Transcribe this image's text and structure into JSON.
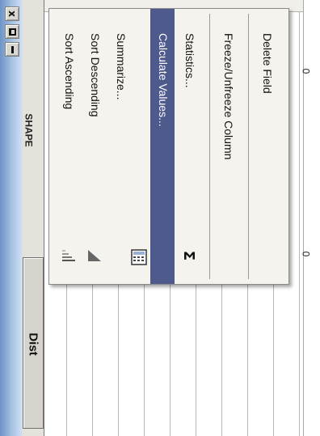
{
  "window": {
    "close_glyph": "x",
    "maximize_icon": "maximize-icon",
    "minimize_icon": "minimize-icon"
  },
  "table": {
    "columns": [
      {
        "label": "Dist"
      },
      {
        "label": "SHAPE"
      }
    ],
    "cell_values": [
      "0",
      "0"
    ]
  },
  "context_menu": {
    "items": [
      {
        "label": "Sort Ascending",
        "icon": "sort-ascending-icon"
      },
      {
        "label": "Sort Descending",
        "icon": "sort-descending-icon"
      },
      {
        "label": "Summarize...",
        "icon": ""
      },
      {
        "label": "Calculate Values...",
        "icon": "calculator-icon",
        "highlighted": true
      },
      {
        "label": "Statistics...",
        "icon": "sigma-icon"
      },
      {
        "label": "Freeze/Unfreeze Column",
        "icon": ""
      },
      {
        "label": "Delete Field",
        "icon": ""
      }
    ],
    "highlight_color": "#4e5a8c"
  }
}
